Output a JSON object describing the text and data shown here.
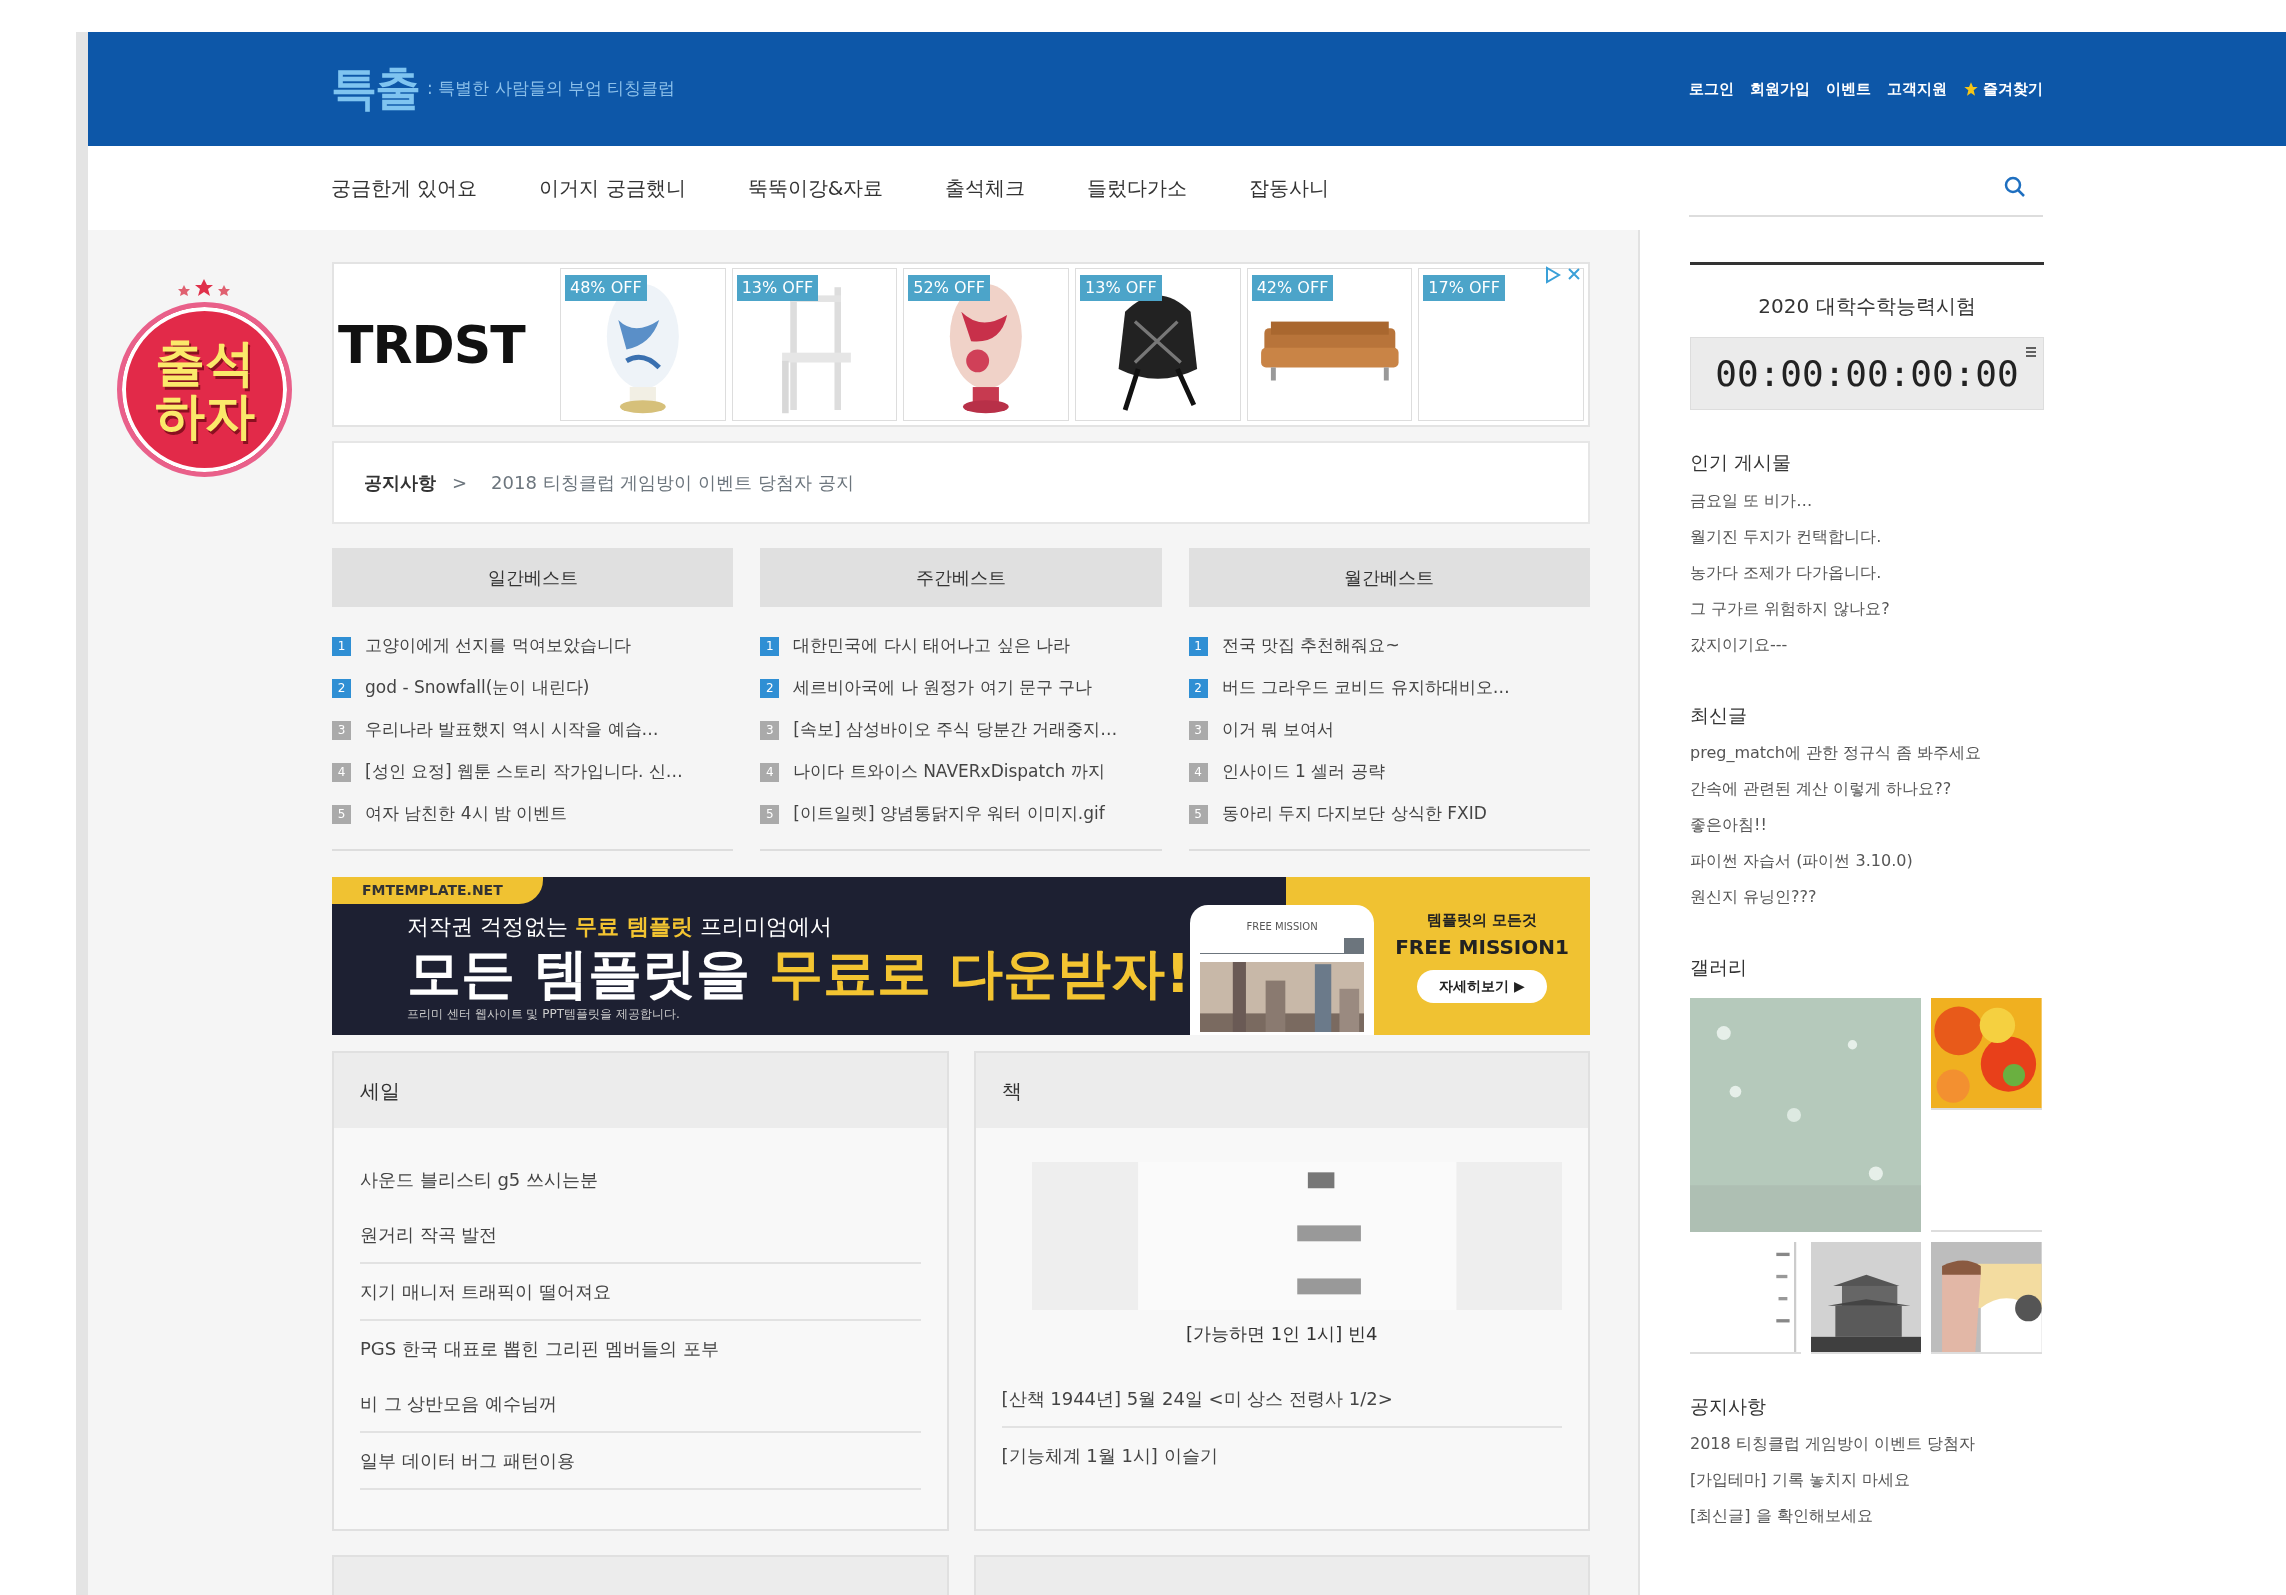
{
  "header": {
    "logo": "특출",
    "tagline": ": 특별한 사람들의 부업 티칭클럽",
    "links": [
      {
        "label": "로그인",
        "kind": "text"
      },
      {
        "label": "회원가입",
        "kind": "text"
      },
      {
        "label": "이벤트",
        "kind": "text"
      },
      {
        "label": "고객지원",
        "kind": "text"
      },
      {
        "label": "즐겨찾기",
        "kind": "favorite"
      }
    ]
  },
  "nav": {
    "items": [
      "궁금한게 있어요",
      "이거지 궁금했니",
      "뚝뚝이강&자료",
      "출석체크",
      "들렀다가소",
      "잡동사니"
    ]
  },
  "attendance_badge": {
    "line1": "출석",
    "line2": "하자"
  },
  "ad": {
    "brand": "TRDST",
    "products": [
      {
        "discount": "48% OFF",
        "kind": "vase"
      },
      {
        "discount": "13% OFF",
        "kind": "chair"
      },
      {
        "discount": "52% OFF",
        "kind": "urn"
      },
      {
        "discount": "13% OFF",
        "kind": "bag"
      },
      {
        "discount": "42% OFF",
        "kind": "sofa"
      },
      {
        "discount": "17% OFF",
        "kind": "blank"
      }
    ]
  },
  "notice_bar": {
    "label": "공지사항",
    "arrow": ">",
    "text": "2018 티칭클럽 게임방이 이벤트 당첨자 공지"
  },
  "best_lists": [
    {
      "title": "일간베스트",
      "items": [
        {
          "rank": "1",
          "title": "고양이에게 선지를 먹여보았습니다",
          "highlighted": true
        },
        {
          "rank": "2",
          "title": "god - Snowfall(눈이 내린다)",
          "highlighted": true
        },
        {
          "rank": "3",
          "title": "우리나라 발표했지 역시 시작을 예습…",
          "highlighted": false
        },
        {
          "rank": "4",
          "title": "[성인 요정] 웹툰 스토리 작가입니다. 신…",
          "highlighted": false
        },
        {
          "rank": "5",
          "title": "여자 남친한 4시 밤 이벤트",
          "highlighted": false
        }
      ]
    },
    {
      "title": "주간베스트",
      "items": [
        {
          "rank": "1",
          "title": "대한민국에 다시 태어나고 싶은 나라",
          "highlighted": true
        },
        {
          "rank": "2",
          "title": "세르비아국에 나 원정가 여기 문구 구나",
          "highlighted": true
        },
        {
          "rank": "3",
          "title": "[속보] 삼성바이오 주식 당분간 거래중지…",
          "highlighted": false
        },
        {
          "rank": "4",
          "title": "나이다 트와이스 NAVERxDispatch 까지",
          "highlighted": false
        },
        {
          "rank": "5",
          "title": "[이트일렛] 양념통닭지우 워터 이미지.gif",
          "highlighted": false
        }
      ]
    },
    {
      "title": "월간베스트",
      "items": [
        {
          "rank": "1",
          "title": "전국 맛집 추천해줘요~",
          "highlighted": true
        },
        {
          "rank": "2",
          "title": "버드 그라우드 코비드 유지하대비오…",
          "highlighted": true
        },
        {
          "rank": "3",
          "title": "이거 뭐 보여서",
          "highlighted": false
        },
        {
          "rank": "4",
          "title": "인사이드 1 셀러 공략",
          "highlighted": false
        },
        {
          "rank": "5",
          "title": "동아리 두지 다지보단 상식한 FXID",
          "highlighted": false
        }
      ]
    }
  ],
  "banner": {
    "site": "FMTEMPLATE.NET",
    "line1": "저작권 걱정없는 **무료 템플릿** 프리미엄에서",
    "headline": "모든 템플릿을 **무료로 다운받자!**",
    "subline": "프리미 센터 웹사이트 및 PPT템플릿을 제공합니다.",
    "phone_title": "FREE MISSION",
    "side_small": "템플릿의 모든것",
    "side_title": "FREE MISSION1",
    "side_button": "자세히보기 ▶"
  },
  "panels": [
    {
      "title": "세일",
      "kind": "list",
      "items": [
        "사운드 블리스티 g5 쓰시는분",
        "원거리 작곡 발전",
        "지기 매니저 트래픽이 떨어져요",
        "PGS 한국 대표로 뽑힌 그리핀 멤버들의 포부",
        "비 그 상반모음 예수님꺼",
        "일부 데이터 버그 패턴이용"
      ]
    },
    {
      "title": "책",
      "kind": "featured",
      "caption": "[가능하면 1인 1시] 빈4",
      "items": [
        "[산책 1944년] 5월 24일 <미 상스 전령사 1/2>",
        "[기능체계 1월 1시] 이슬기"
      ]
    }
  ],
  "sidebar": {
    "countdown": {
      "title": "2020 대학수학능력시험",
      "time": "00:00:00:00:00"
    },
    "sections": [
      {
        "title": "인기 게시물",
        "kind": "links",
        "items": [
          "금요일 또 비가…",
          "월기진 두지가 컨택합니다.",
          "농가다 조제가 다가옵니다.",
          "그 구가르 위험하지 않나요?",
          "갔지이기요---"
        ]
      },
      {
        "title": "최신글",
        "kind": "links",
        "items": [
          "preg_match에 관한 정규식 좀 봐주세요",
          "간속에 관련된 계산 이렇게 하나요??",
          "좋은아침!!",
          "파이썬 자습서 (파이썬 3.10.0)",
          "원신지 유닝인???"
        ]
      },
      {
        "title": "갤러리",
        "kind": "gallery",
        "tiles": [
          {
            "kind": "mist"
          },
          {
            "kind": "leaves"
          },
          {
            "kind": "blank"
          },
          {
            "kind": "document"
          },
          {
            "kind": "building"
          },
          {
            "kind": "cartoon"
          }
        ]
      },
      {
        "title": "공지사항",
        "kind": "links",
        "items": [
          "2018 티칭클럽 게임방이 이벤트 당첨자",
          "[가입테마] 기록 놓치지 마세요",
          "[최신글] 을 확인해보세요"
        ]
      }
    ]
  }
}
